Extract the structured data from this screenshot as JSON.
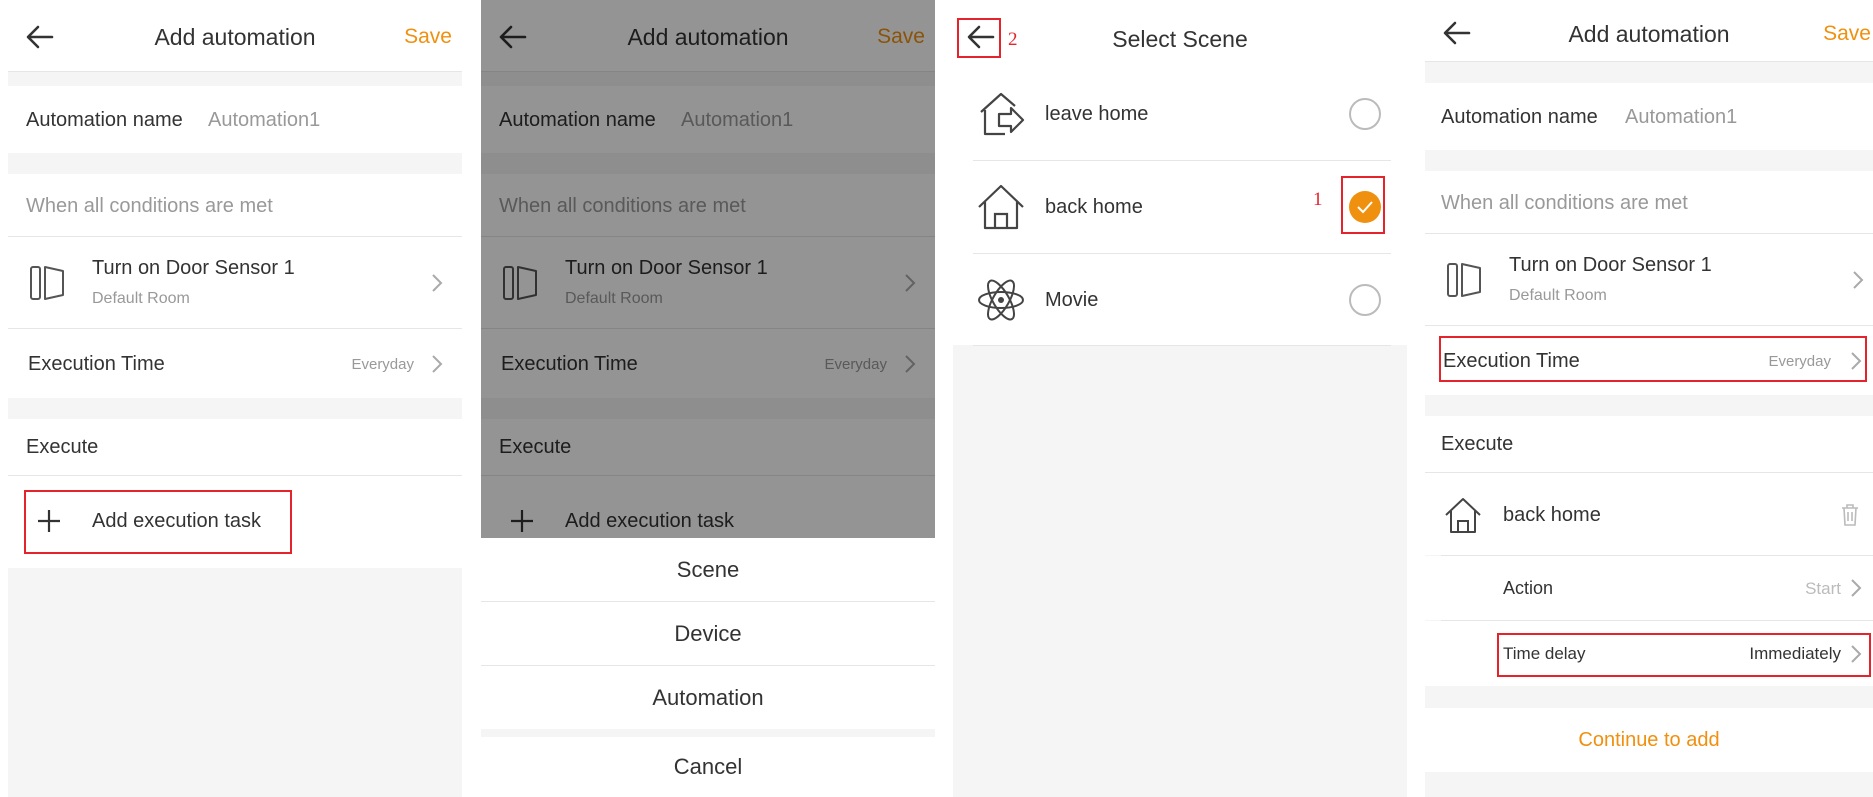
{
  "colors": {
    "accent": "#f0900f",
    "highlight": "#e5232b",
    "text": "#333333",
    "muted": "#999999",
    "background": "#f5f5f5"
  },
  "panel1": {
    "title": "Add automation",
    "save": "Save",
    "name_label": "Automation name",
    "name_value": "Automation1",
    "conditions_header": "When all conditions are met",
    "condition_title": "Turn on Door Sensor 1",
    "condition_room": "Default Room",
    "execution_time_label": "Execution Time",
    "execution_time_value": "Everyday",
    "execute_header": "Execute",
    "add_task": "Add execution task"
  },
  "panel2": {
    "title": "Add automation",
    "save": "Save",
    "name_label": "Automation name",
    "name_value": "Automation1",
    "conditions_header": "When all conditions are met",
    "condition_title": "Turn on Door Sensor 1",
    "condition_room": "Default Room",
    "execution_time_label": "Execution Time",
    "execution_time_value": "Everyday",
    "execute_header": "Execute",
    "add_task": "Add execution task",
    "sheet": {
      "scene": "Scene",
      "device": "Device",
      "automation": "Automation",
      "cancel": "Cancel"
    }
  },
  "panel3": {
    "title": "Select Scene",
    "step_back": "2",
    "step_select": "1",
    "scenes": [
      {
        "name": "leave home",
        "icon": "leave-home-icon",
        "selected": false
      },
      {
        "name": "back home",
        "icon": "home-icon",
        "selected": true
      },
      {
        "name": "Movie",
        "icon": "atom-icon",
        "selected": false
      }
    ]
  },
  "panel4": {
    "title": "Add automation",
    "save": "Save",
    "name_label": "Automation name",
    "name_value": "Automation1",
    "conditions_header": "When all conditions are met",
    "condition_title": "Turn on Door Sensor 1",
    "condition_room": "Default Room",
    "execution_time_label": "Execution Time",
    "execution_time_value": "Everyday",
    "execute_header": "Execute",
    "task_name": "back home",
    "action_label": "Action",
    "action_value": "Start",
    "delay_label": "Time delay",
    "delay_value": "Immediately",
    "continue": "Continue to add"
  }
}
